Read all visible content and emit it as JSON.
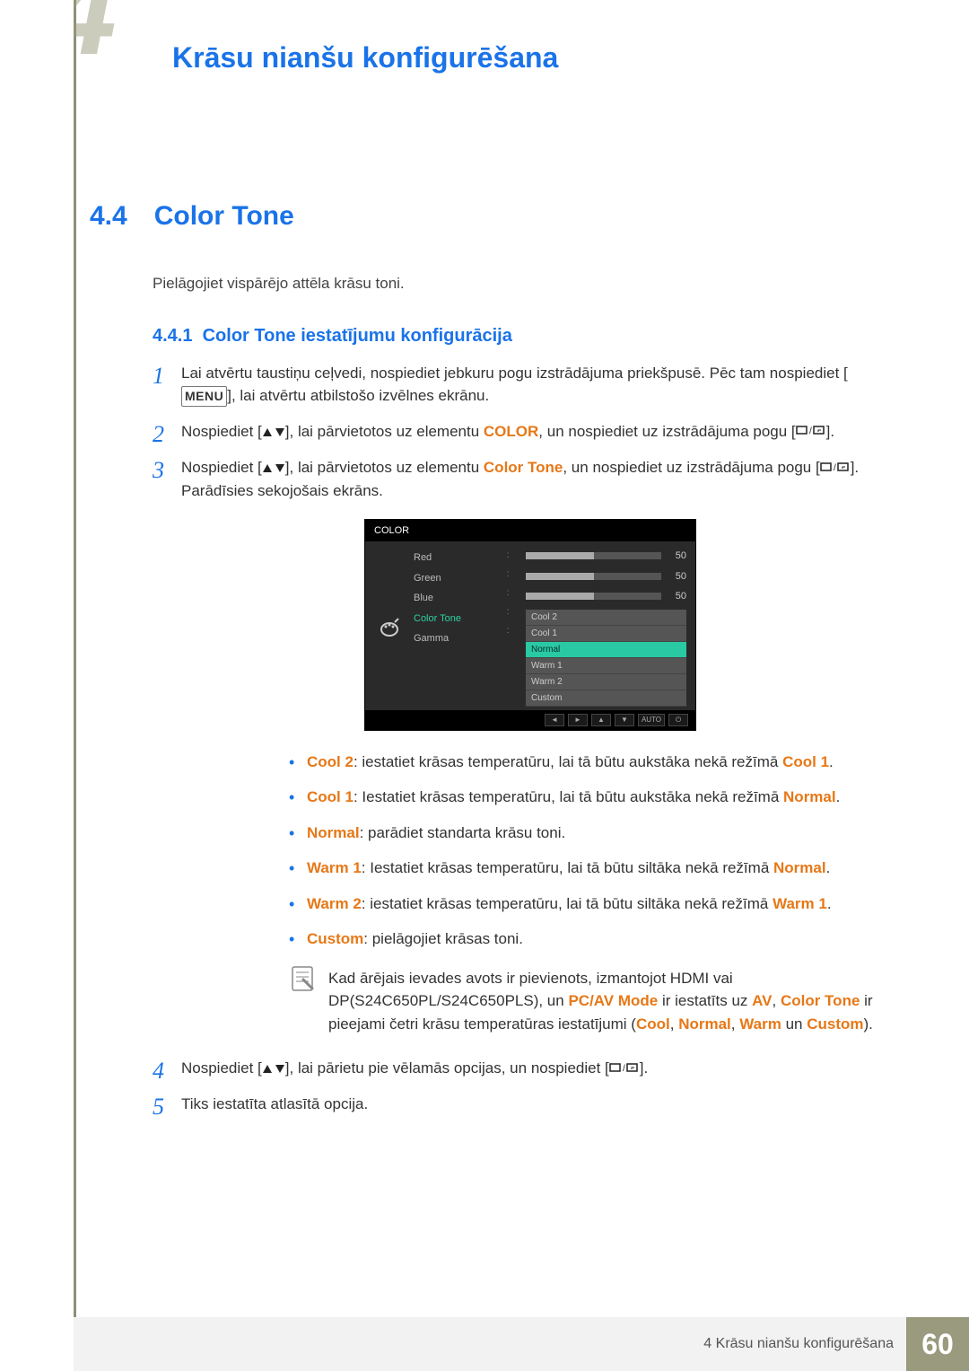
{
  "doc_title": "Krāsu nianšu konfigurēšana",
  "section": {
    "num": "4.4",
    "title": "Color Tone"
  },
  "intro": "Pielāgojiet vispārējo attēla krāsu toni.",
  "subsection": {
    "num": "4.4.1",
    "title": "Color Tone iestatījumu konfigurācija"
  },
  "steps": {
    "s1a": "Lai atvērtu taustiņu ceļvedi, nospiediet jebkuru pogu izstrādājuma priekšpusē. Pēc tam nospiediet [",
    "s1b": "], lai atvērtu atbilstošo izvēlnes ekrānu.",
    "menu_word": "MENU",
    "s2a": "Nospiediet [",
    "s2b": "], lai pārvietotos uz elementu ",
    "s2_color": "COLOR",
    "s2c": ", un nospiediet uz izstrādājuma pogu [",
    "s2d": "].",
    "s3a": "Nospiediet [",
    "s3b": "], lai pārvietotos uz elementu ",
    "s3_ct": "Color Tone",
    "s3c": ", un nospiediet uz izstrādājuma pogu [",
    "s3d": "]. Parādīsies sekojošais ekrāns.",
    "s4a": "Nospiediet [",
    "s4b": "], lai pārietu pie vēlamās opcijas, un nospiediet [",
    "s4c": "].",
    "s5": "Tiks iestatīta atlasītā opcija."
  },
  "osd": {
    "title": "COLOR",
    "labels": {
      "red": "Red",
      "green": "Green",
      "blue": "Blue",
      "colortone": "Color Tone",
      "gamma": "Gamma"
    },
    "values": {
      "red": "50",
      "green": "50",
      "blue": "50"
    },
    "options": {
      "cool2": "Cool 2",
      "cool1": "Cool 1",
      "normal": "Normal",
      "warm1": "Warm 1",
      "warm2": "Warm 2",
      "custom": "Custom"
    },
    "footer_auto": "AUTO"
  },
  "defs": {
    "cool2_k": "Cool 2",
    "cool2_t": ": iestatiet krāsas temperatūru, lai tā būtu aukstāka nekā režīmā ",
    "cool2_r": "Cool 1",
    "cool1_k": "Cool 1",
    "cool1_t": ": Iestatiet krāsas temperatūru, lai tā būtu aukstāka nekā režīmā ",
    "cool1_r": "Normal",
    "normal_k": "Normal",
    "normal_t": ": parādiet standarta krāsu toni.",
    "warm1_k": "Warm 1",
    "warm1_t": ": Iestatiet krāsas temperatūru, lai tā būtu siltāka nekā režīmā ",
    "warm1_r": "Normal",
    "warm2_k": "Warm 2",
    "warm2_t": ": iestatiet krāsas temperatūru, lai tā būtu siltāka nekā režīmā ",
    "warm2_r": "Warm 1",
    "custom_k": "Custom",
    "custom_t": ": pielāgojiet krāsas toni."
  },
  "note": {
    "t1": "Kad ārējais ievades avots ir pievienots, izmantojot HDMI vai DP(S24C650PL/S24C650PLS), un ",
    "k_pcav": "PC/AV Mode",
    "t2": " ir iestatīts uz ",
    "k_av": "AV",
    "t3": ", ",
    "k_ct": "Color Tone",
    "t4": " ir pieejami četri krāsu temperatūras iestatījumi (",
    "k_cool": "Cool",
    "t5": ", ",
    "k_normal": "Normal",
    "t6": ", ",
    "k_warm": "Warm",
    "t7": " un ",
    "k_custom": "Custom",
    "t8": ")."
  },
  "footer": {
    "chapter_label": "4 Krāsu nianšu konfigurēšana",
    "page": "60"
  }
}
